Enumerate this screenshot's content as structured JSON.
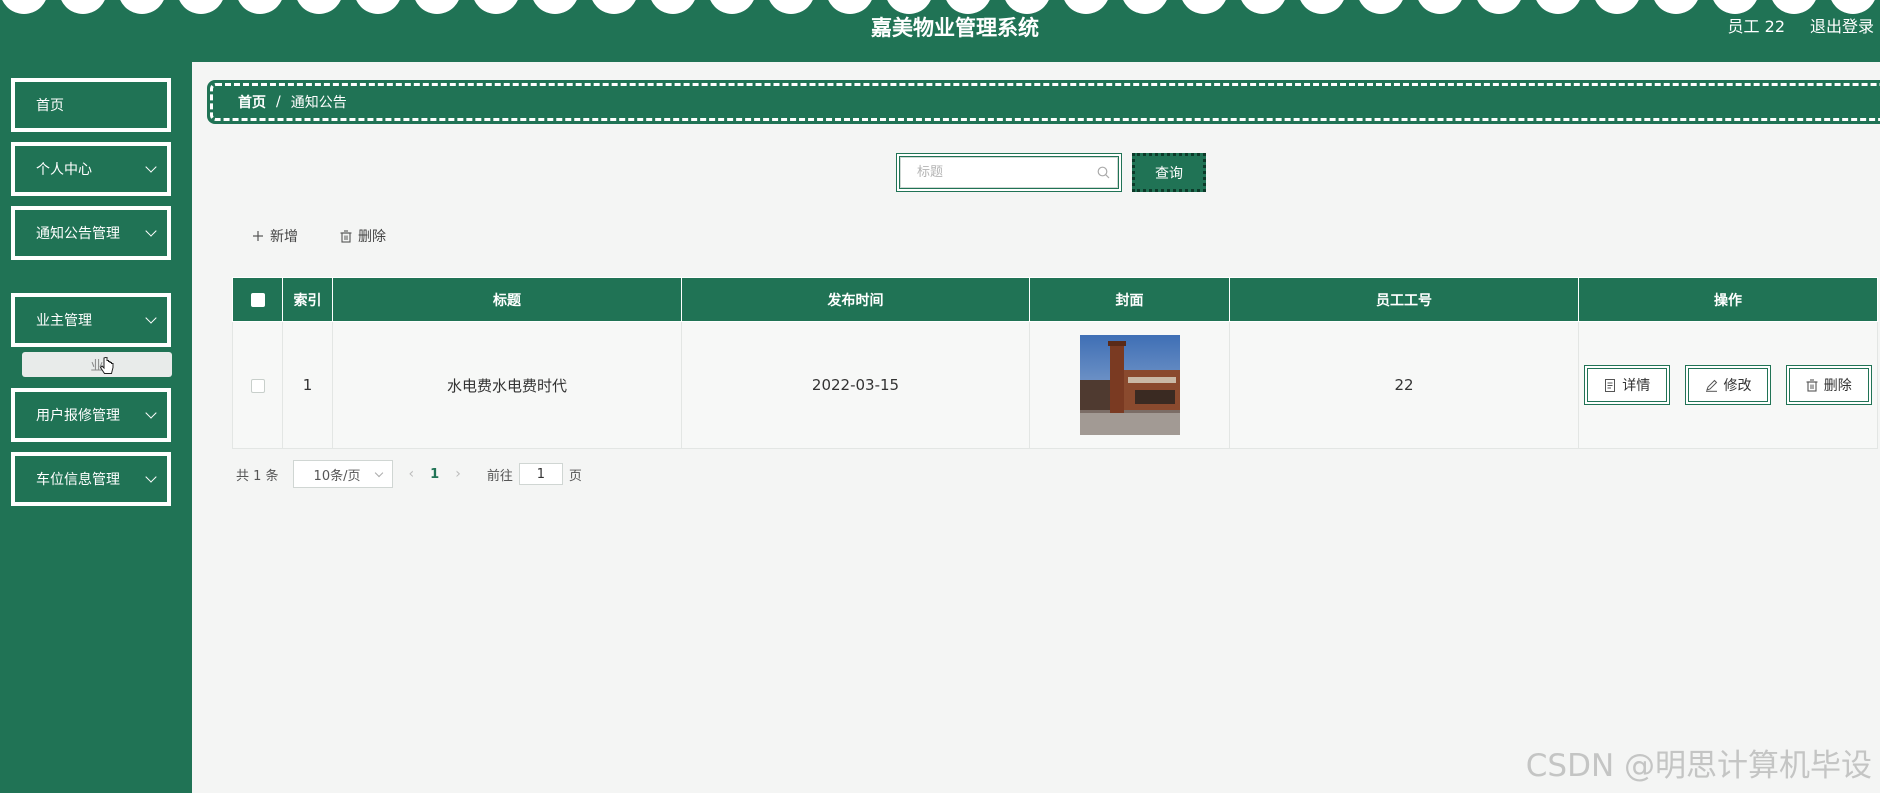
{
  "header": {
    "title": "嘉美物业管理系统",
    "user": "员工 22",
    "logout": "退出登录"
  },
  "sidebar": {
    "items": [
      {
        "label": "首页"
      },
      {
        "label": "个人中心"
      },
      {
        "label": "通知公告管理"
      },
      {
        "label": "业主管理"
      },
      {
        "label": "用户报修管理"
      },
      {
        "label": "车位信息管理"
      }
    ],
    "sub_item": "业"
  },
  "breadcrumb": {
    "home": "首页",
    "sep": "/",
    "current": "通知公告"
  },
  "search": {
    "placeholder": "标题",
    "button": "查询"
  },
  "actions": {
    "add": "新增",
    "delete": "删除"
  },
  "table": {
    "headers": [
      "索引",
      "标题",
      "发布时间",
      "封面",
      "员工工号",
      "操作"
    ],
    "rows": [
      {
        "index": "1",
        "title": "水电费水电费时代",
        "date": "2022-03-15",
        "emp_id": "22"
      }
    ],
    "ops": {
      "detail": "详情",
      "edit": "修改",
      "delete": "删除"
    }
  },
  "pager": {
    "total": "共 1 条",
    "page_size": "10条/页",
    "current": "1",
    "goto_label": "前往",
    "goto_value": "1",
    "page_suffix": "页"
  },
  "watermark": "CSDN @明思计算机毕设",
  "colors": {
    "primary": "#207355"
  }
}
